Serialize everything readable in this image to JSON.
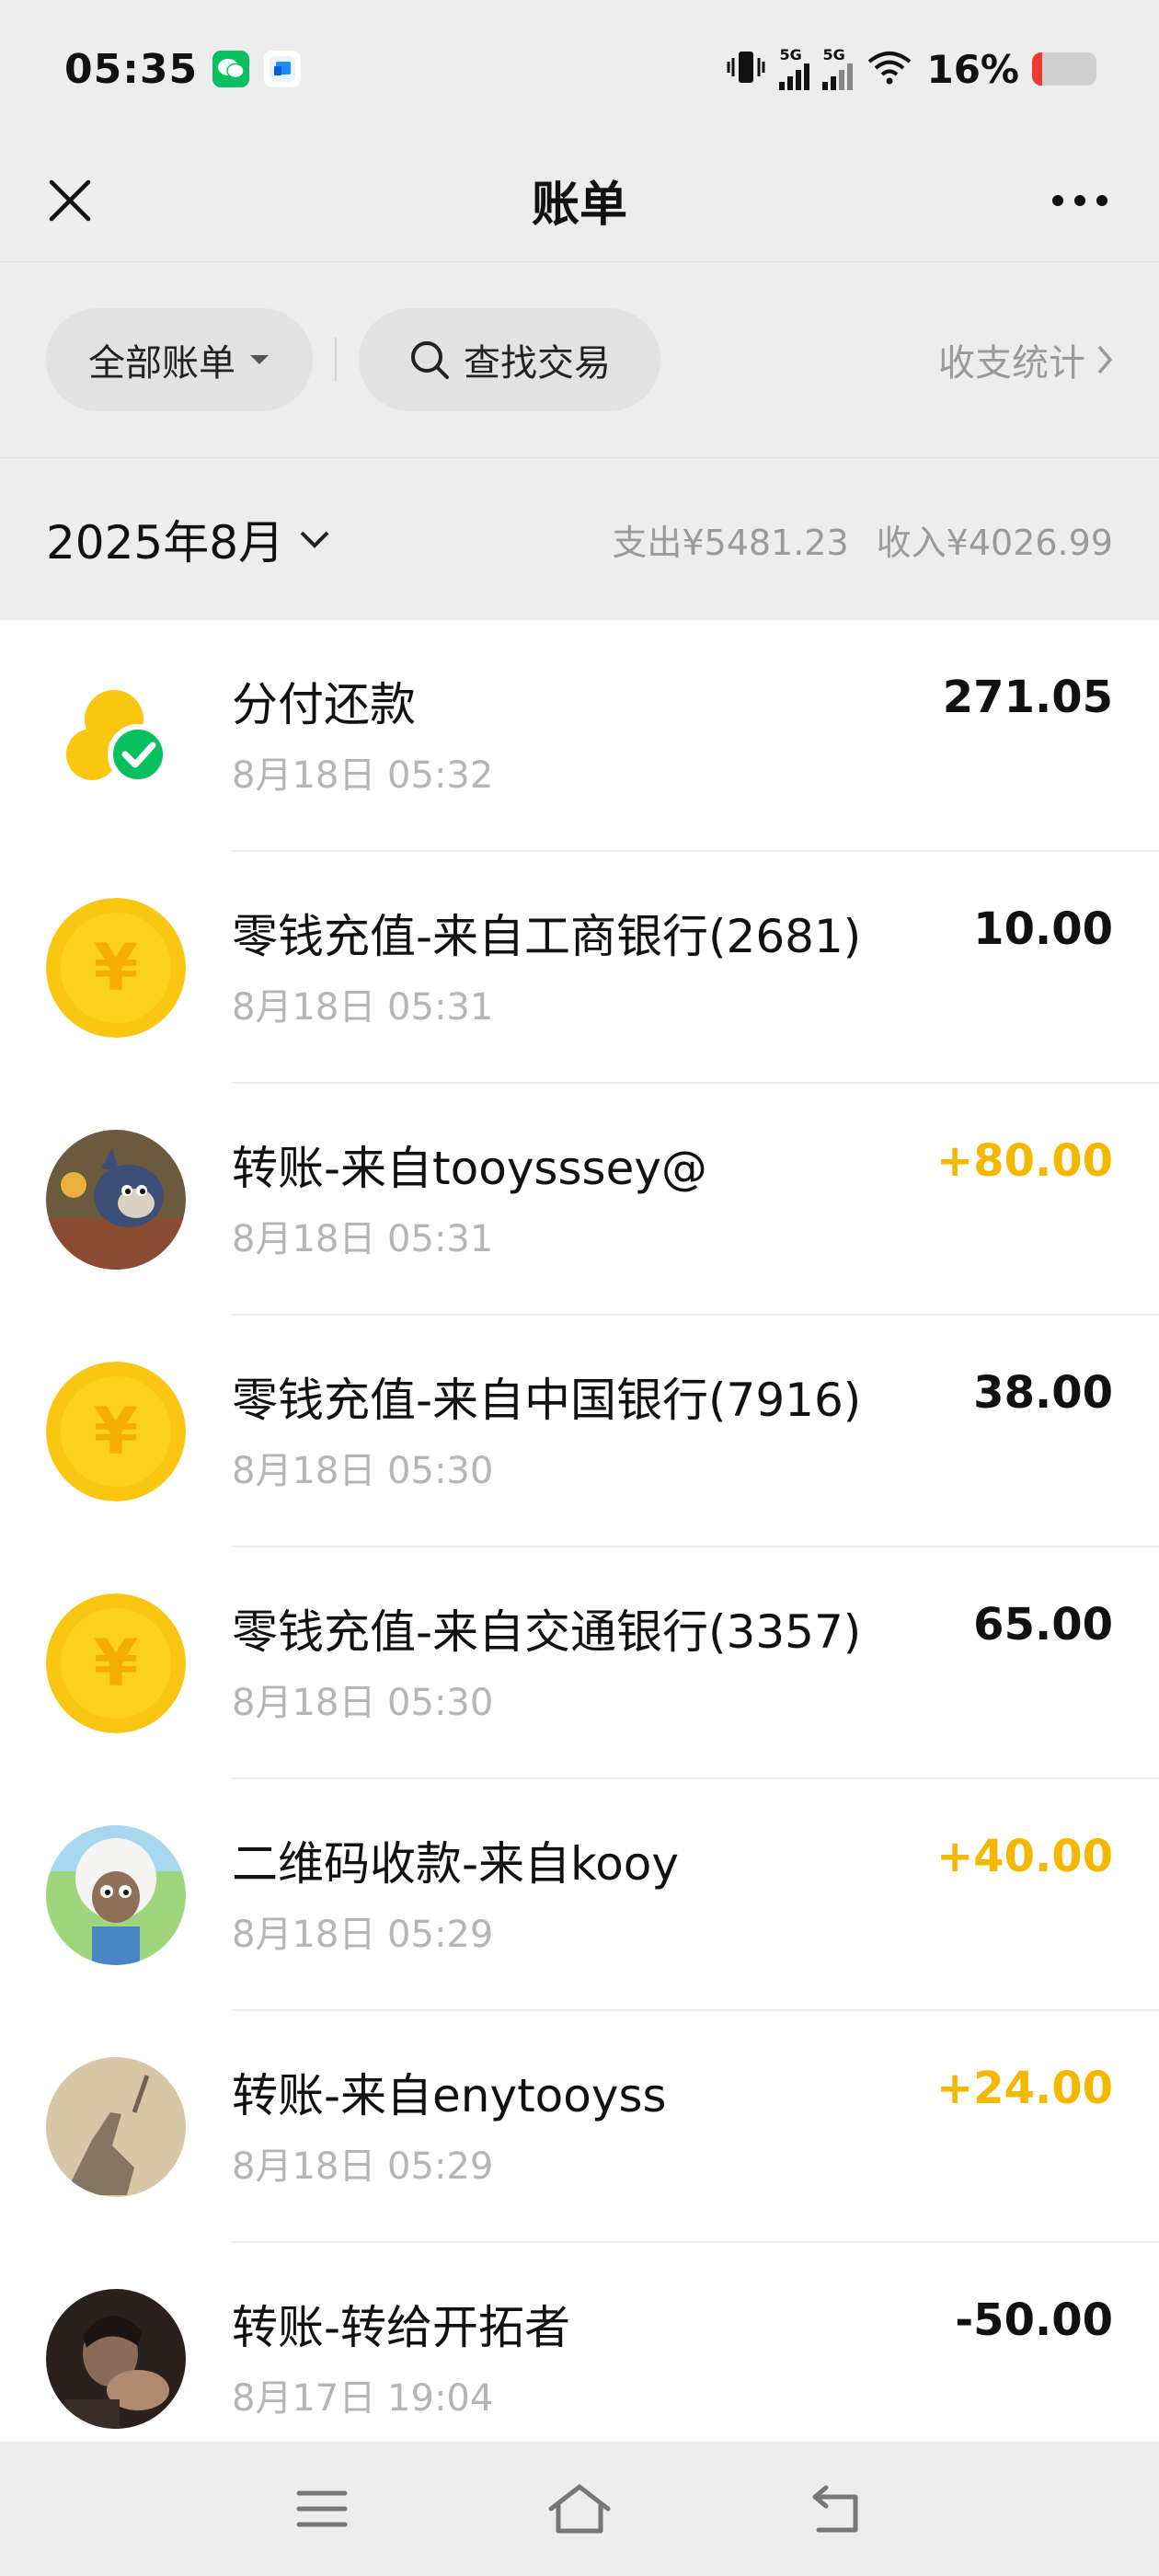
{
  "status_bar": {
    "time": "05:35",
    "network_1": "5G",
    "network_2": "5G",
    "battery_percent": "16%",
    "battery_level": 0.16,
    "icons": [
      "wechat-icon",
      "blue-app-icon",
      "vibrate-icon",
      "signal-icon",
      "wifi-icon",
      "battery-icon"
    ]
  },
  "header": {
    "title": "账单",
    "close_icon": "close-icon",
    "more_icon": "more-icon"
  },
  "filters": {
    "all_bills_label": "全部账单",
    "search_label": "查找交易",
    "stats_label": "收支统计"
  },
  "month": {
    "label": "2025年8月",
    "expense": "支出¥5481.23",
    "income": "收入¥4026.99"
  },
  "transactions": [
    {
      "title": "分付还款",
      "time": "8月18日 05:32",
      "amount": "271.05",
      "type": "expense",
      "icon": "fenfu-icon"
    },
    {
      "title": "零钱充值-来自工商银行(2681)",
      "time": "8月18日 05:31",
      "amount": "10.00",
      "type": "expense",
      "icon": "yuan-coin-icon"
    },
    {
      "title": "转账-来自tooysssey@",
      "time": "8月18日 05:31",
      "amount": "+80.00",
      "type": "income",
      "icon": "cartoon-cat-avatar"
    },
    {
      "title": "零钱充值-来自中国银行(7916)",
      "time": "8月18日 05:30",
      "amount": "38.00",
      "type": "expense",
      "icon": "yuan-coin-icon"
    },
    {
      "title": "零钱充值-来自交通银行(3357)",
      "time": "8月18日 05:30",
      "amount": "65.00",
      "type": "expense",
      "icon": "yuan-coin-icon"
    },
    {
      "title": "二维码收款-来自kooy",
      "time": "8月18日 05:29",
      "amount": "+40.00",
      "type": "income",
      "icon": "cartoon-sheep-avatar"
    },
    {
      "title": "转账-来自enytooyss",
      "time": "8月18日 05:29",
      "amount": "+24.00",
      "type": "income",
      "icon": "shadow-photo-avatar"
    },
    {
      "title": "转账-转给开拓者",
      "time": "8月17日 19:04",
      "amount": "-50.00",
      "type": "expense",
      "icon": "person-photo-avatar"
    }
  ],
  "colors": {
    "background": "#ededed",
    "income": "#f5b800",
    "coin": "#f9c711",
    "wechat_green": "#07c160"
  }
}
